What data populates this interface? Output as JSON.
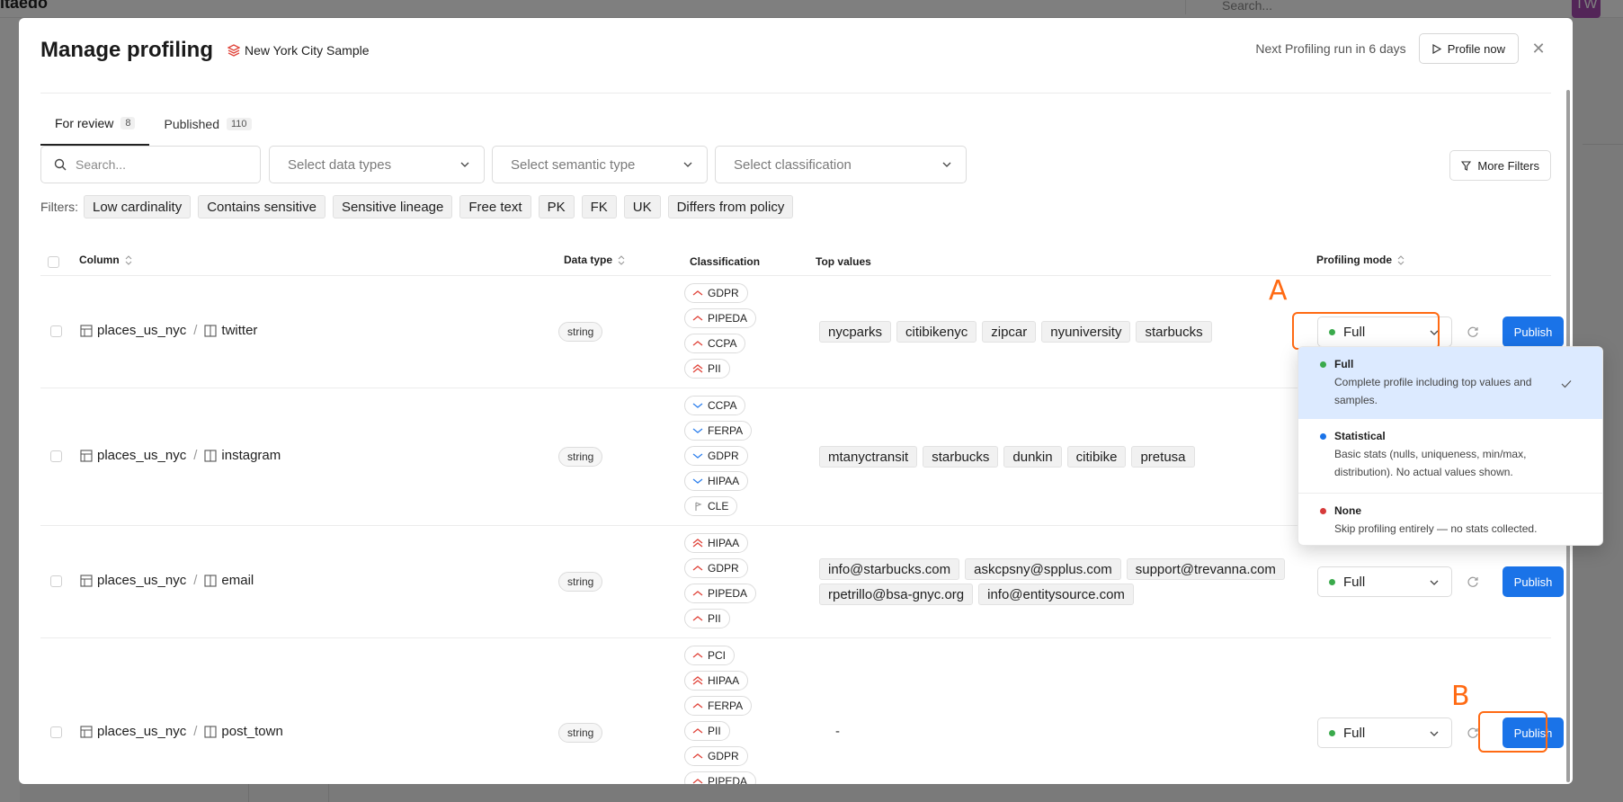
{
  "background": {
    "logo_text": "itaedo",
    "search_placeholder": "Search...",
    "avatar": "TW"
  },
  "modal": {
    "title": "Manage profiling",
    "database": "New York City Sample",
    "next_run": "Next Profiling run in 6 days",
    "profile_now": "Profile now",
    "close_icon": "close-icon"
  },
  "tabs": [
    {
      "label": "For review",
      "count": "8",
      "active": true
    },
    {
      "label": "Published",
      "count": "110",
      "active": false
    }
  ],
  "toolbar": {
    "search_placeholder": "Search...",
    "data_types": "Select data types",
    "semantic_type": "Select semantic type",
    "classification": "Select classification",
    "more_filters": "More Filters"
  },
  "quick_filters": {
    "label": "Filters:",
    "chips": [
      "Low cardinality",
      "Contains sensitive",
      "Sensitive lineage",
      "Free text",
      "PK",
      "FK",
      "UK",
      "Differs from policy"
    ]
  },
  "table": {
    "headers": {
      "column": "Column",
      "data_type": "Data type",
      "classification": "Classification",
      "top_values": "Top values",
      "profiling_mode": "Profiling mode"
    },
    "rows": [
      {
        "table": "places_us_nyc",
        "column": "twitter",
        "type": "string",
        "classifications": [
          {
            "label": "GDPR",
            "level": "up"
          },
          {
            "label": "PIPEDA",
            "level": "up"
          },
          {
            "label": "CCPA",
            "level": "up"
          },
          {
            "label": "PII",
            "level": "double-up"
          }
        ],
        "top_values": [
          "nycparks",
          "citibikenyc",
          "zipcar",
          "nyuniversity",
          "starbucks"
        ],
        "mode": "Full",
        "publish": "Publish"
      },
      {
        "table": "places_us_nyc",
        "column": "instagram",
        "type": "string",
        "classifications": [
          {
            "label": "CCPA",
            "level": "down"
          },
          {
            "label": "FERPA",
            "level": "down"
          },
          {
            "label": "GDPR",
            "level": "down"
          },
          {
            "label": "HIPAA",
            "level": "down"
          },
          {
            "label": "CLE",
            "level": "flag"
          }
        ],
        "top_values": [
          "mtanyctransit",
          "starbucks",
          "dunkin",
          "citibike",
          "pretusa"
        ],
        "mode": "Full",
        "publish": "Publish"
      },
      {
        "table": "places_us_nyc",
        "column": "email",
        "type": "string",
        "classifications": [
          {
            "label": "HIPAA",
            "level": "double-up"
          },
          {
            "label": "GDPR",
            "level": "up"
          },
          {
            "label": "PIPEDA",
            "level": "up"
          },
          {
            "label": "PII",
            "level": "up"
          }
        ],
        "top_values": [
          "info@starbucks.com",
          "askcpsny@spplus.com",
          "support@trevanna.com",
          "rpetrillo@bsa-gnyc.org",
          "info@entitysource.com"
        ],
        "mode": "Full",
        "publish": "Publish"
      },
      {
        "table": "places_us_nyc",
        "column": "post_town",
        "type": "string",
        "classifications": [
          {
            "label": "PCI",
            "level": "up"
          },
          {
            "label": "HIPAA",
            "level": "double-up"
          },
          {
            "label": "FERPA",
            "level": "up"
          },
          {
            "label": "PII",
            "level": "up"
          },
          {
            "label": "GDPR",
            "level": "up"
          },
          {
            "label": "PIPEDA",
            "level": "up"
          }
        ],
        "top_values_empty": "-",
        "mode": "Full",
        "publish": "Publish"
      }
    ]
  },
  "dropdown": {
    "options": [
      {
        "title": "Full",
        "desc": "Complete profile including top values and samples.",
        "color": "#3aaa4c",
        "selected": true
      },
      {
        "title": "Statistical",
        "desc": "Basic stats (nulls, uniqueness, min/max, distribution). No actual values shown.",
        "color": "#1a73e8",
        "selected": false
      },
      {
        "title": "None",
        "desc": "Skip profiling entirely — no stats collected.",
        "color": "#d63b3b",
        "selected": false
      }
    ]
  },
  "annotations": {
    "a": "A",
    "b": "B",
    "color": "#ff6a13"
  },
  "colors": {
    "accent": "#1a73e8",
    "risk_up": "#e0443a",
    "risk_down": "#2f80ed"
  }
}
